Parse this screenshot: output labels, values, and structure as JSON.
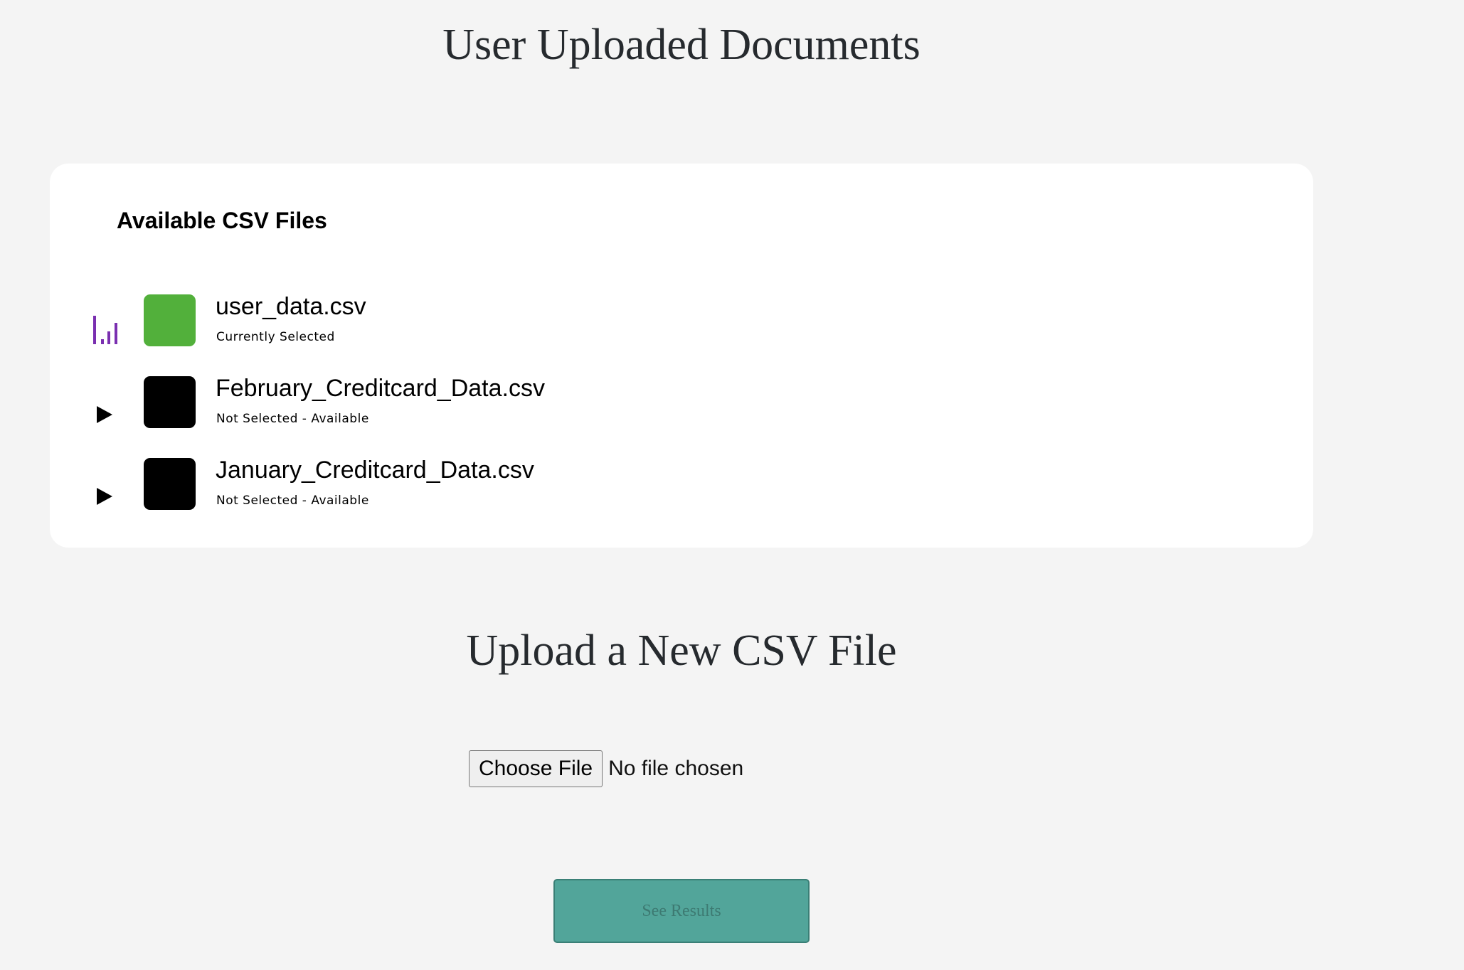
{
  "header": {
    "title": "User Uploaded Documents"
  },
  "files_card": {
    "heading": "Available CSV Files",
    "files": [
      {
        "name": "user_data.csv",
        "status": "Currently Selected",
        "icon": "bar-chart-icon",
        "thumbnail_color": "#52b03b"
      },
      {
        "name": "February_Creditcard_Data.csv",
        "status": "Not Selected - Available",
        "icon": "play-icon",
        "thumbnail_color": "#000000"
      },
      {
        "name": "January_Creditcard_Data.csv",
        "status": "Not Selected - Available",
        "icon": "play-icon",
        "thumbnail_color": "#000000"
      }
    ]
  },
  "upload": {
    "title": "Upload a New CSV File",
    "choose_file_label": "Choose File",
    "no_file_text": "No file chosen"
  },
  "actions": {
    "see_results_label": "See Results"
  },
  "colors": {
    "accent_bar_icon": "#7a2fb0",
    "see_results_bg": "#52a59a",
    "selected_thumbnail": "#52b03b"
  }
}
